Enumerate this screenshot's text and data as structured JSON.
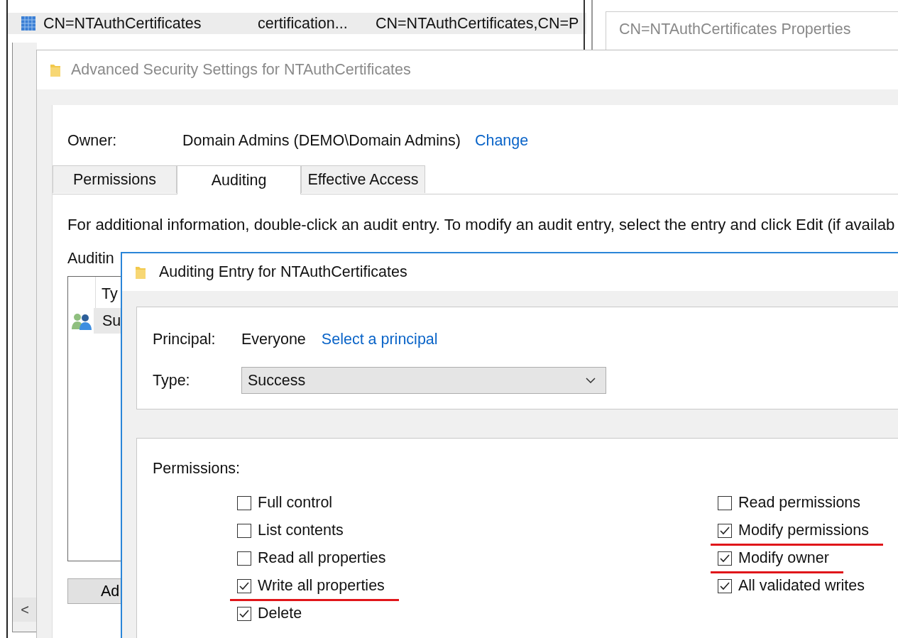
{
  "background_list": {
    "row": {
      "column_1": "CN=NTAuthCertificates",
      "column_2": "certification...",
      "column_3": "CN=NTAuthCertificates,CN=P",
      "selected": true
    }
  },
  "properties_window": {
    "title": "CN=NTAuthCertificates Properties"
  },
  "scroll_left": "<",
  "advanced_security": {
    "title": "Advanced Security Settings for NTAuthCertificates",
    "owner_label": "Owner:",
    "owner": "Domain Admins (DEMO\\Domain Admins)",
    "change_link": "Change",
    "tabs": [
      {
        "label": "Permissions",
        "selected": false
      },
      {
        "label": "Auditing",
        "selected": true
      },
      {
        "label": "Effective Access",
        "selected": false
      }
    ],
    "info": "For additional information, double-click an audit entry. To modify an audit entry, select the entry and click Edit (if availab",
    "entries_label": "Auditin",
    "list": {
      "column_1": "Ty",
      "rows": [
        {
          "column_1": "Su"
        }
      ]
    },
    "add_button": "Ad"
  },
  "auditing_entry": {
    "title": "Auditing Entry for NTAuthCertificates",
    "principal_label": "Principal:",
    "principal": "Everyone",
    "select_link": "Select a principal",
    "type_label": "Type:",
    "type_value": "Success",
    "permissions_label": "Permissions:",
    "left_permissions": [
      {
        "label": "Full control",
        "checked": false,
        "highlighted": false
      },
      {
        "label": "List contents",
        "checked": false,
        "highlighted": false
      },
      {
        "label": "Read all properties",
        "checked": false,
        "highlighted": false
      },
      {
        "label": "Write all properties",
        "checked": true,
        "highlighted": true
      },
      {
        "label": "Delete",
        "checked": true,
        "highlighted": false
      }
    ],
    "right_permissions": [
      {
        "label": "Read permissions",
        "checked": false,
        "highlighted": false
      },
      {
        "label": "Modify permissions",
        "checked": true,
        "highlighted": true
      },
      {
        "label": "Modify owner",
        "checked": true,
        "highlighted": true
      },
      {
        "label": "All validated writes",
        "checked": true,
        "highlighted": false
      }
    ]
  }
}
